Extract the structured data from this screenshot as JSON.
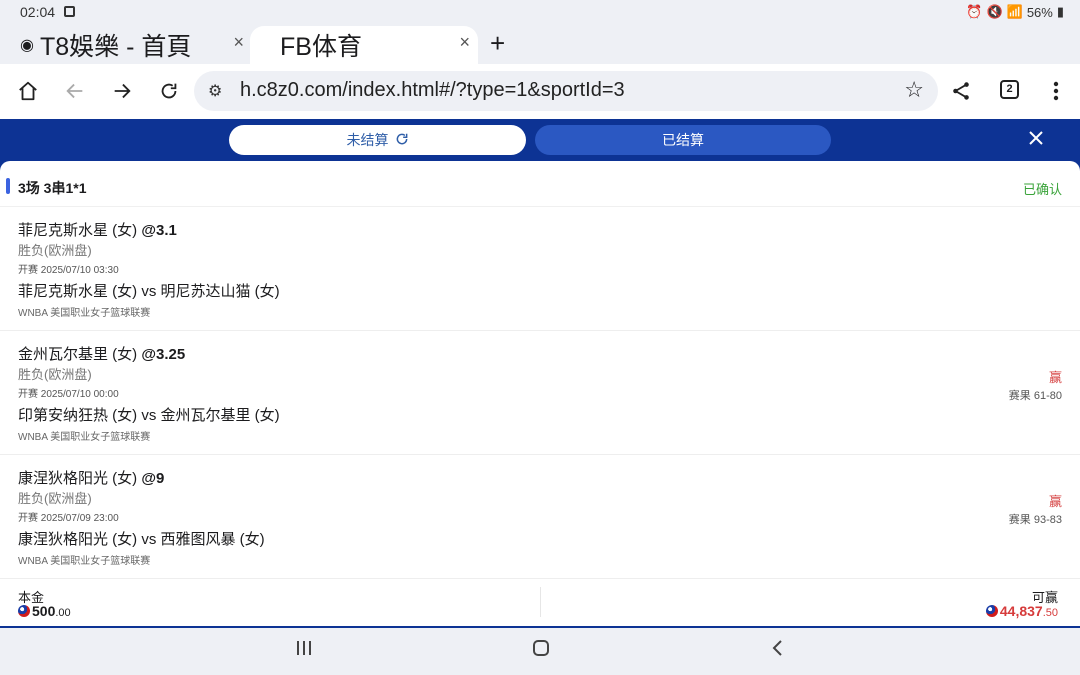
{
  "status_bar": {
    "time": "02:04",
    "battery": "56%"
  },
  "browser": {
    "tabs": [
      {
        "title": "T8娛樂 - 首頁",
        "close": "×"
      },
      {
        "title": "FB体育",
        "close": "×"
      }
    ],
    "new_tab": "+",
    "url": "h.c8z0.com/index.html#/?type=1&sportId=3",
    "tab_count": "2"
  },
  "header": {
    "tab_unsettled": "未结算",
    "tab_settled": "已结算"
  },
  "ticket": {
    "title": "3场 3串1*1",
    "status": "已确认",
    "bets": [
      {
        "selection": "菲尼克斯水星 (女)",
        "odds": "@3.1",
        "market": "胜负(欧洲盘)",
        "kickoff": "开赛  2025/07/10 03:30",
        "match": "菲尼克斯水星 (女) vs 明尼苏达山猫 (女)",
        "league": "WNBA 美国职业女子篮球联赛",
        "result": "",
        "score": ""
      },
      {
        "selection": "金州瓦尔基里 (女)",
        "odds": "@3.25",
        "market": "胜负(欧洲盘)",
        "kickoff": "开赛  2025/07/10 00:00",
        "match": "印第安纳狂热 (女) vs 金州瓦尔基里 (女)",
        "league": "WNBA 美国职业女子篮球联赛",
        "result": "赢",
        "score": "赛果  61-80"
      },
      {
        "selection": "康涅狄格阳光 (女)",
        "odds": "@9",
        "market": "胜负(欧洲盘)",
        "kickoff": "开赛  2025/07/09 23:00",
        "match": "康涅狄格阳光 (女) vs 西雅图风暴 (女)",
        "league": "WNBA 美国职业女子篮球联赛",
        "result": "赢",
        "score": "赛果  93-83"
      }
    ],
    "stake_label": "本金",
    "stake_int": "500",
    "stake_dec": ".00",
    "payout_label": "可赢",
    "payout_int": "44,837",
    "payout_dec": ".50"
  },
  "colors": {
    "header_blue": "#0d3394",
    "win_red": "#d64545",
    "confirmed_green": "#3aa33a"
  }
}
